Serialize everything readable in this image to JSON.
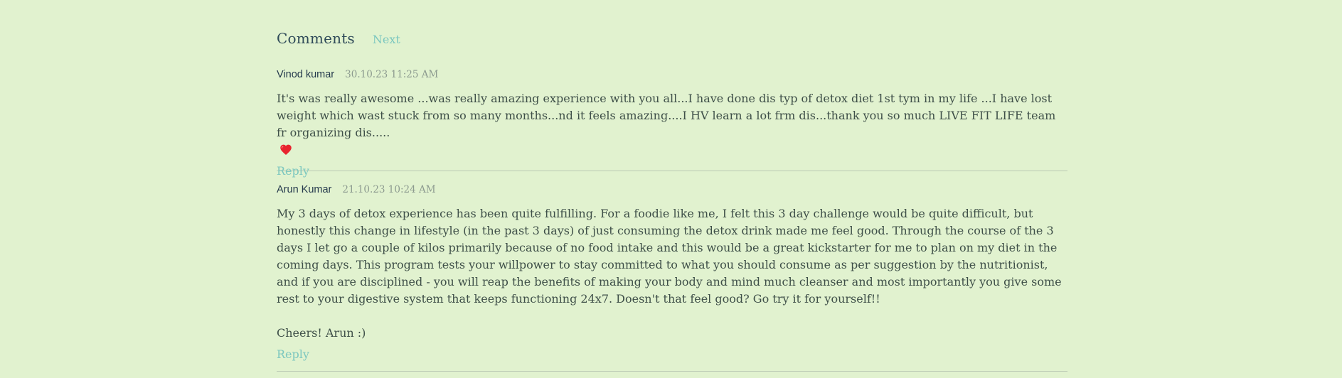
{
  "comments_section": {
    "title": "Comments",
    "next_label": "Next"
  },
  "comments": [
    {
      "author": "Vinod kumar",
      "timestamp": "30.10.23 11:25 AM",
      "body": "It's was really awesome ...was really amazing experience with you all...I have done dis typ of detox diet 1st tym in my life ...I have lost weight which wast stuck from so many months...nd it feels amazing....I HV learn a lot frm dis...thank you so much LIVE FIT LIFE team fr organizing dis.....",
      "emoji_icon": "heart-icon",
      "reply_label": "Reply"
    },
    {
      "author": "Arun Kumar",
      "timestamp": "21.10.23 10:24 AM",
      "body": "My 3 days of detox experience has been quite fulfilling. For a foodie like me, I felt this 3 day challenge would be quite difficult, but honestly this change in lifestyle (in the past 3 days) of just consuming the detox drink made me feel good. Through the course of the 3 days I let go a couple of kilos primarily because of no food intake and this would be a great kickstarter for me to plan on my diet in the coming days. This program tests your willpower to stay committed to what you should consume as per suggestion by the nutritionist, and if you are disciplined - you will reap the benefits of making your body and mind much cleanser and most importantly you give some rest to your digestive system that keeps functioning 24x7. Doesn't that feel good? Go try it for yourself!!",
      "signoff": "Cheers! Arun :)",
      "reply_label": "Reply"
    }
  ],
  "colors": {
    "background": "#e1f2cf",
    "accent_link": "#7cc7bf",
    "heading": "#2e4a58",
    "body_text": "#3e4f48",
    "divider": "#b9c8b3"
  }
}
